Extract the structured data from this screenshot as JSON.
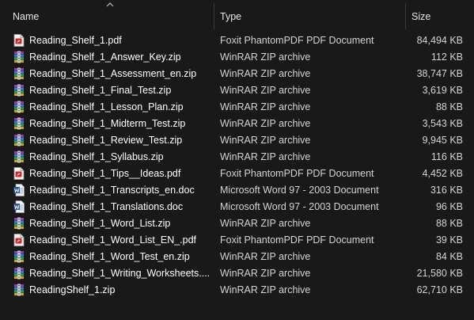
{
  "columns": {
    "name": "Name",
    "type": "Type",
    "size": "Size"
  },
  "files": [
    {
      "name": "Reading_Shelf_1.pdf",
      "type": "Foxit PhantomPDF PDF Document",
      "size": "84,494 KB",
      "icon": "pdf-icon"
    },
    {
      "name": "Reading_Shelf_1_Answer_Key.zip",
      "type": "WinRAR ZIP archive",
      "size": "112 KB",
      "icon": "zip-icon"
    },
    {
      "name": "Reading_Shelf_1_Assessment_en.zip",
      "type": "WinRAR ZIP archive",
      "size": "38,747 KB",
      "icon": "zip-icon"
    },
    {
      "name": "Reading_Shelf_1_Final_Test.zip",
      "type": "WinRAR ZIP archive",
      "size": "3,619 KB",
      "icon": "zip-icon"
    },
    {
      "name": "Reading_Shelf_1_Lesson_Plan.zip",
      "type": "WinRAR ZIP archive",
      "size": "88 KB",
      "icon": "zip-icon"
    },
    {
      "name": "Reading_Shelf_1_Midterm_Test.zip",
      "type": "WinRAR ZIP archive",
      "size": "3,543 KB",
      "icon": "zip-icon"
    },
    {
      "name": "Reading_Shelf_1_Review_Test.zip",
      "type": "WinRAR ZIP archive",
      "size": "9,945 KB",
      "icon": "zip-icon"
    },
    {
      "name": "Reading_Shelf_1_Syllabus.zip",
      "type": "WinRAR ZIP archive",
      "size": "116 KB",
      "icon": "zip-icon"
    },
    {
      "name": "Reading_Shelf_1_Tips__Ideas.pdf",
      "type": "Foxit PhantomPDF PDF Document",
      "size": "4,452 KB",
      "icon": "pdf-icon"
    },
    {
      "name": "Reading_Shelf_1_Transcripts_en.doc",
      "type": "Microsoft Word 97 - 2003 Document",
      "size": "316 KB",
      "icon": "word-icon"
    },
    {
      "name": "Reading_Shelf_1_Translations.doc",
      "type": "Microsoft Word 97 - 2003 Document",
      "size": "96 KB",
      "icon": "word-icon"
    },
    {
      "name": "Reading_Shelf_1_Word_List.zip",
      "type": "WinRAR ZIP archive",
      "size": "88 KB",
      "icon": "zip-icon"
    },
    {
      "name": "Reading_Shelf_1_Word_List_EN_.pdf",
      "type": "Foxit PhantomPDF PDF Document",
      "size": "39 KB",
      "icon": "pdf-icon"
    },
    {
      "name": "Reading_Shelf_1_Word_Test_en.zip",
      "type": "WinRAR ZIP archive",
      "size": "84 KB",
      "icon": "zip-icon"
    },
    {
      "name": "Reading_Shelf_1_Writing_Worksheets....",
      "type": "WinRAR ZIP archive",
      "size": "21,580 KB",
      "icon": "zip-icon"
    },
    {
      "name": "ReadingShelf_1.zip",
      "type": "WinRAR ZIP archive",
      "size": "62,710 KB",
      "icon": "zip-icon"
    }
  ],
  "colors": {
    "background": "#191919",
    "text": "#ffffff",
    "secondary_text": "#d4d4d4",
    "pdf_red": "#d6262b",
    "word_blue": "#2b5797"
  }
}
